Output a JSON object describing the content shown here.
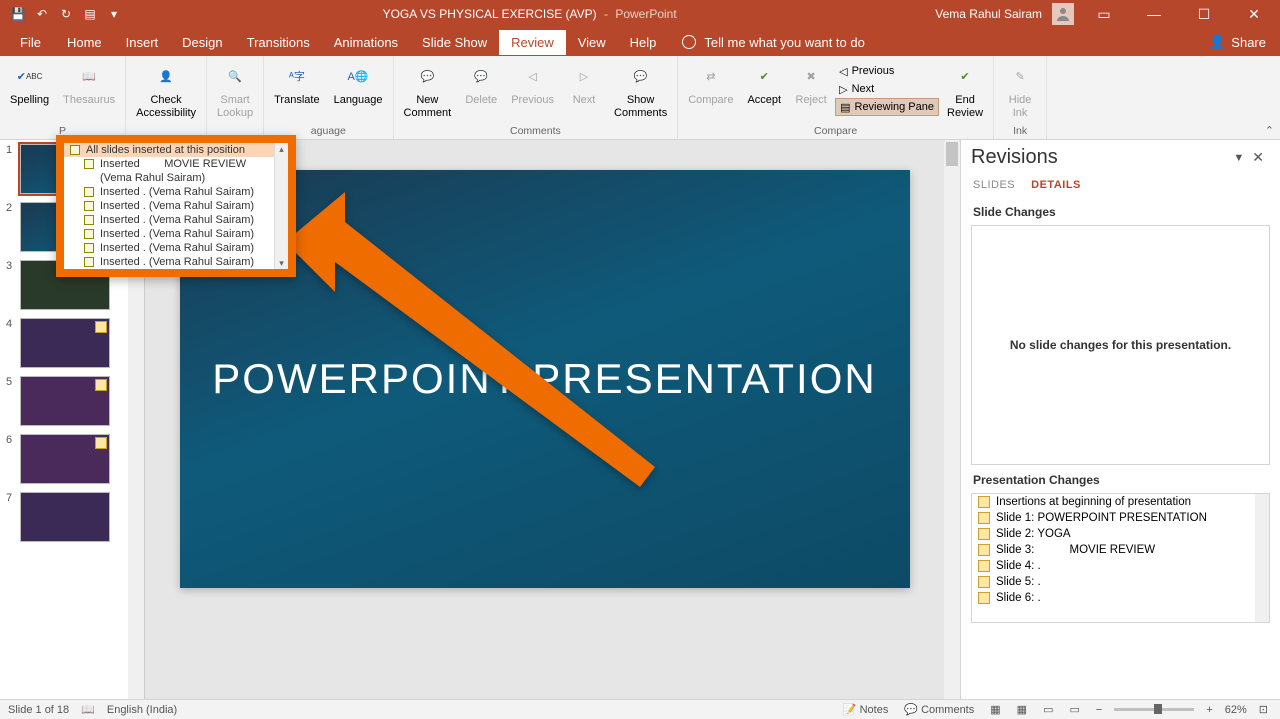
{
  "titlebar": {
    "document": "YOGA VS PHYSICAL EXERCISE (AVP)",
    "app": "PowerPoint",
    "user": "Vema Rahul Sairam"
  },
  "menutabs": {
    "file": "File",
    "home": "Home",
    "insert": "Insert",
    "design": "Design",
    "transitions": "Transitions",
    "animations": "Animations",
    "slideshow": "Slide Show",
    "review": "Review",
    "view": "View",
    "help": "Help",
    "tellme": "Tell me what you want to do",
    "share": "Share"
  },
  "ribbon": {
    "proofing": {
      "spelling": "Spelling",
      "thesaurus": "Thesaurus",
      "label": "P"
    },
    "accessibility": {
      "check": "Check\nAccessibility"
    },
    "insights": {
      "smart": "Smart\nLookup"
    },
    "language": {
      "translate": "Translate",
      "language": "Language",
      "label": "aguage"
    },
    "comments": {
      "new": "New\nComment",
      "delete": "Delete",
      "previous": "Previous",
      "next": "Next",
      "show": "Show\nComments",
      "label": "Comments"
    },
    "compare": {
      "compare": "Compare",
      "accept": "Accept",
      "reject": "Reject",
      "previous": "Previous",
      "next": "Next",
      "reviewing": "Reviewing Pane",
      "end": "End\nReview",
      "label": "Compare"
    },
    "ink": {
      "hide": "Hide\nInk",
      "label": "Ink"
    }
  },
  "slide": {
    "title": "POWERPOINT PRESENTATION"
  },
  "popup": {
    "header": "All slides inserted at this position",
    "items": [
      "Inserted        MOVIE REVIEW",
      "(Vema Rahul Sairam)",
      "Inserted . (Vema Rahul Sairam)",
      "Inserted . (Vema Rahul Sairam)",
      "Inserted . (Vema Rahul Sairam)",
      "Inserted . (Vema Rahul Sairam)",
      "Inserted . (Vema Rahul Sairam)",
      "Inserted . (Vema Rahul Sairam)"
    ]
  },
  "revisions": {
    "title": "Revisions",
    "tab_slides": "SLIDES",
    "tab_details": "DETAILS",
    "slide_changes_h": "Slide Changes",
    "no_changes": "No slide changes for this presentation.",
    "pres_changes_h": "Presentation Changes",
    "items": [
      "Insertions at beginning of presentation",
      "Slide 1: POWERPOINT PRESENTATION",
      "Slide 2: YOGA",
      "Slide 3:           MOVIE REVIEW",
      "Slide 4: .",
      "Slide 5: .",
      "Slide 6: ."
    ]
  },
  "status": {
    "slide": "Slide 1 of 18",
    "lang": "English (India)",
    "notes": "Notes",
    "comments": "Comments",
    "zoom": "62%"
  }
}
